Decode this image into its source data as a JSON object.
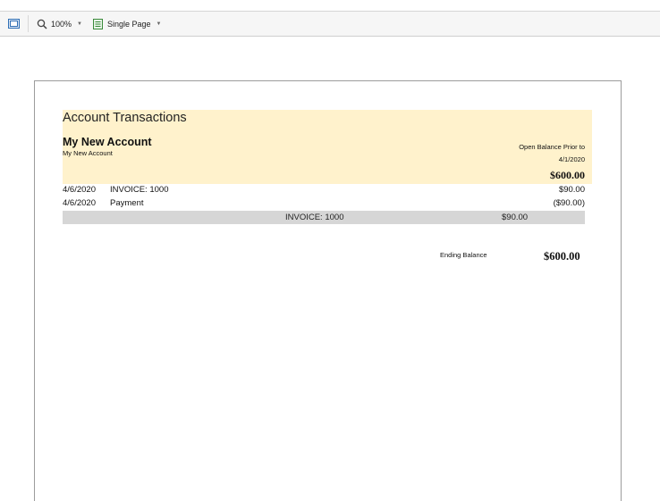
{
  "toolbar": {
    "zoom": "100%",
    "view_mode": "Single Page"
  },
  "report": {
    "title": "Account Transactions",
    "account_name": "My New Account",
    "account_subtitle": "My New Account",
    "open_balance_label": "Open Balance Prior to",
    "open_balance_date": "4/1/2020",
    "open_balance_amount": "$600.00",
    "transactions": [
      {
        "date": "4/6/2020",
        "description": "INVOICE: 1000",
        "amount": "$90.00"
      },
      {
        "date": "4/6/2020",
        "description": "Payment",
        "amount": "($90.00)"
      }
    ],
    "summary": {
      "description": "INVOICE: 1000",
      "amount": "$90.00"
    },
    "ending_balance_label": "Ending Balance",
    "ending_balance_amount": "$600.00"
  },
  "colors": {
    "header_band": "#fff2cc",
    "summary_band": "#d6d6d6",
    "toolbar_icon_blue": "#2f6fb5",
    "toolbar_icon_green": "#3a8a3a"
  }
}
